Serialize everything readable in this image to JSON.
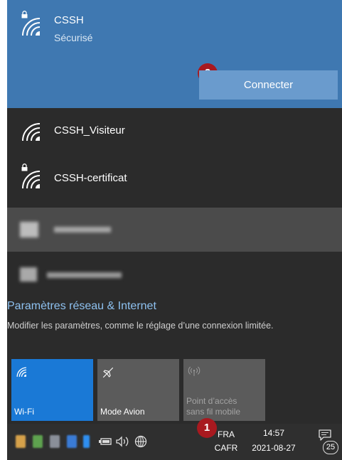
{
  "networks": [
    {
      "ssid": "CSSH",
      "status": "Sécurisé",
      "secured": true,
      "connect_label": "Connecter"
    },
    {
      "ssid": "CSSH_Visiteur",
      "secured": false
    },
    {
      "ssid": "CSSH-certificat",
      "secured": true
    }
  ],
  "annotations": {
    "badge_connect": "2",
    "badge_tray": "1"
  },
  "settings": {
    "link_label": "Paramètres réseau & Internet",
    "description": "Modifier les paramètres, comme le réglage d’une connexion limitée."
  },
  "tiles": [
    {
      "label": "Wi-Fi",
      "icon": "wifi-icon",
      "active": true
    },
    {
      "label": "Mode Avion",
      "icon": "airplane-icon",
      "active": false
    },
    {
      "label": "Point d’accès sans fil mobile",
      "label_line1": "Point d’accès",
      "label_line2": "sans fil mobile",
      "icon": "hotspot-icon",
      "active": false,
      "disabled": true
    }
  ],
  "taskbar": {
    "language_line1": "FRA",
    "language_line2": "CAFR",
    "time": "14:57",
    "date": "2021-08-27",
    "notification_count": "25"
  },
  "colors": {
    "accent": "#3f78b1",
    "connect_button": "#6a9bcd",
    "panel_background": "#2b2b2b",
    "link": "#8ec1f0",
    "badge": "#a8191f",
    "tile_active": "#1a79d6",
    "tile_inactive": "#5b5b5b"
  }
}
